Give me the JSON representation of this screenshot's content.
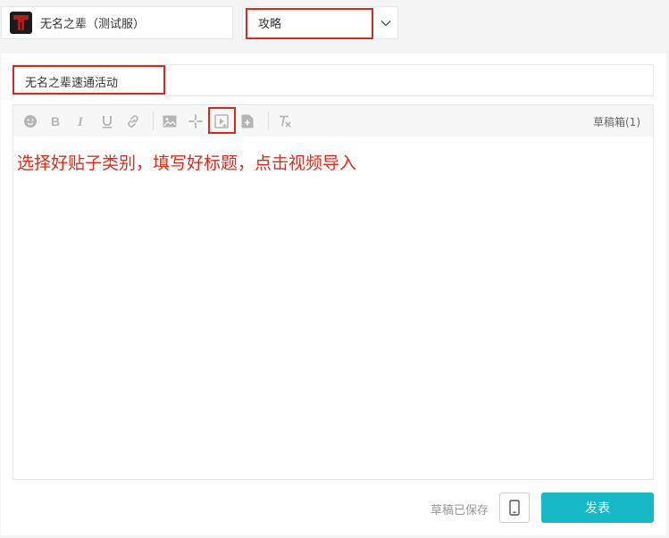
{
  "game": {
    "name": "无名之辈（测试服）",
    "logo": "game-logo-icon"
  },
  "category": {
    "value": "攻略",
    "dropdown_icon": "chevron-down-icon"
  },
  "post": {
    "title": "无名之辈速通活动"
  },
  "toolbar": {
    "icons": [
      "emoji-icon",
      "bold-icon",
      "italic-icon",
      "underline-icon",
      "link-icon",
      "image-icon",
      "sparkle-icon",
      "video-import-icon",
      "file-add-icon",
      "clear-format-icon"
    ],
    "drafts_label": "草稿箱(1)"
  },
  "instruction": "选择好贴子类别，填写好标题，点击视频导入",
  "footer": {
    "status": "草稿已保存",
    "publish_label": "发表",
    "phone_icon": "phone-preview-icon"
  },
  "colors": {
    "accent": "#17b9c6",
    "annotation": "#d62a1e",
    "instruction": "#e02a1a",
    "icon": "#b5b5b5"
  }
}
